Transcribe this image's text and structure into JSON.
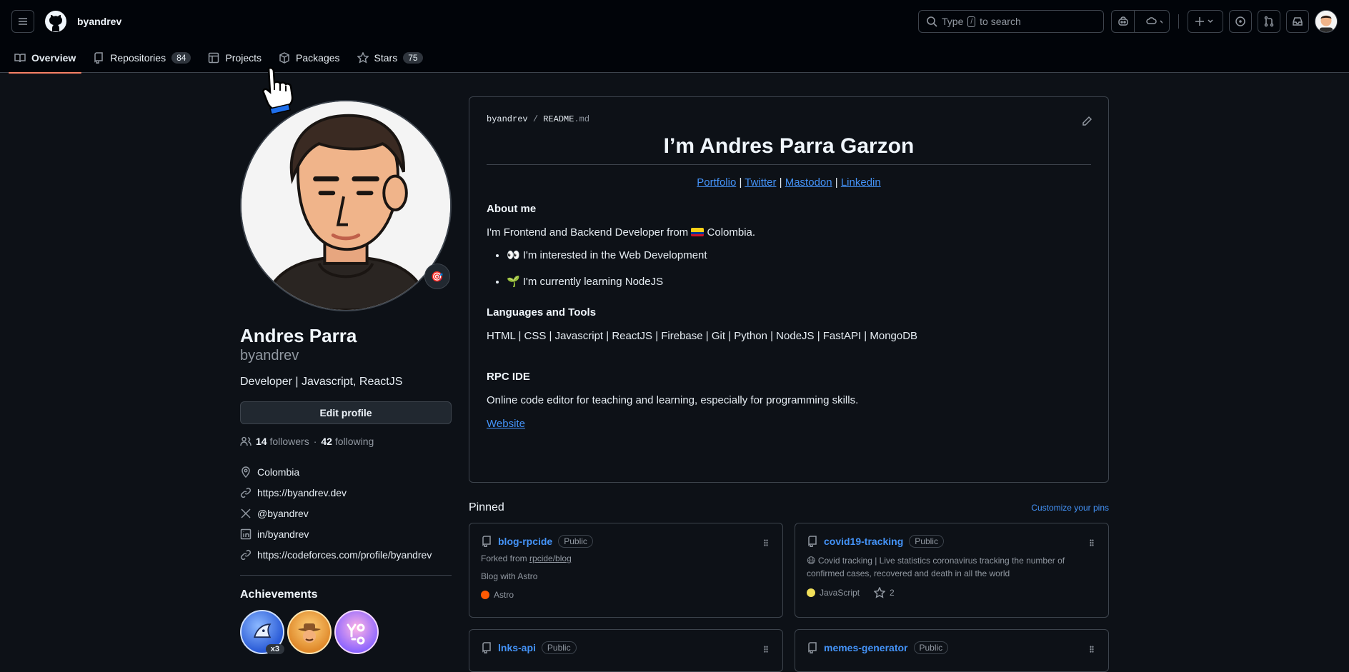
{
  "header": {
    "username": "byandrev",
    "search_prefix": "Type",
    "search_key": "/",
    "search_suffix": "to search"
  },
  "tabs": [
    {
      "label": "Overview",
      "active": true
    },
    {
      "label": "Repositories",
      "count": "84"
    },
    {
      "label": "Projects"
    },
    {
      "label": "Packages"
    },
    {
      "label": "Stars",
      "count": "75"
    }
  ],
  "profile": {
    "full_name": "Andres Parra",
    "login": "byandrev",
    "bio": "Developer | Javascript, ReactJS",
    "edit_label": "Edit profile",
    "followers_count": "14",
    "followers_label": "followers",
    "separator": "·",
    "following_count": "42",
    "following_label": "following",
    "status_emoji": "🎯",
    "details": [
      {
        "icon": "location-icon",
        "text": "Colombia"
      },
      {
        "icon": "link-icon",
        "text": "https://byandrev.dev"
      },
      {
        "icon": "x-icon",
        "text": "@byandrev"
      },
      {
        "icon": "linkedin-icon",
        "text": "in/byandrev"
      },
      {
        "icon": "link-icon",
        "text": "https://codeforces.com/profile/byandrev"
      }
    ],
    "achievements_title": "Achievements",
    "achievement_count": "x3"
  },
  "readme": {
    "path_owner": "byandrev",
    "path_sep": "/",
    "path_file": "README",
    "path_ext": ".md",
    "title": "I’m Andres Parra Garzon",
    "links": [
      "Portfolio",
      "Twitter",
      "Mastodon",
      "Linkedin"
    ],
    "link_sep": "|",
    "about_title": "About me",
    "about_text_1": "I'm Frontend and Backend Developer from",
    "about_text_2": "Colombia.",
    "bullet_1": "👀 I'm interested in the Web Development",
    "bullet_2": "🌱 I'm currently learning NodeJS",
    "tools_title": "Languages and Tools",
    "tools_text": "HTML | CSS | Javascript | ReactJS | Firebase | Git | Python | NodeJS | FastAPI | MongoDB",
    "rpc_title": "RPC IDE",
    "rpc_text": "Online code editor for teaching and learning, especially for programming skills.",
    "website_label": "Website"
  },
  "pinned": {
    "title": "Pinned",
    "customize_label": "Customize your pins",
    "cards": [
      {
        "name": "blog-rpcide",
        "visibility": "Public",
        "forked_prefix": "Forked from",
        "forked_from": "rpcide/blog",
        "desc": "Blog with Astro",
        "lang": "Astro",
        "lang_color": "#ff5a03"
      },
      {
        "name": "covid19-tracking",
        "visibility": "Public",
        "desc": "😷 Covid tracking | Live statistics coronavirus tracking the number of confirmed cases, recovered and death in all the world",
        "lang": "JavaScript",
        "lang_color": "#f1e05a",
        "stars": "2"
      },
      {
        "name": "lnks-api",
        "visibility": "Public"
      },
      {
        "name": "memes-generator",
        "visibility": "Public"
      }
    ]
  },
  "colors": {
    "accent": "#4493f8",
    "tab_underline": "#f78166",
    "bg": "#0d1117"
  }
}
